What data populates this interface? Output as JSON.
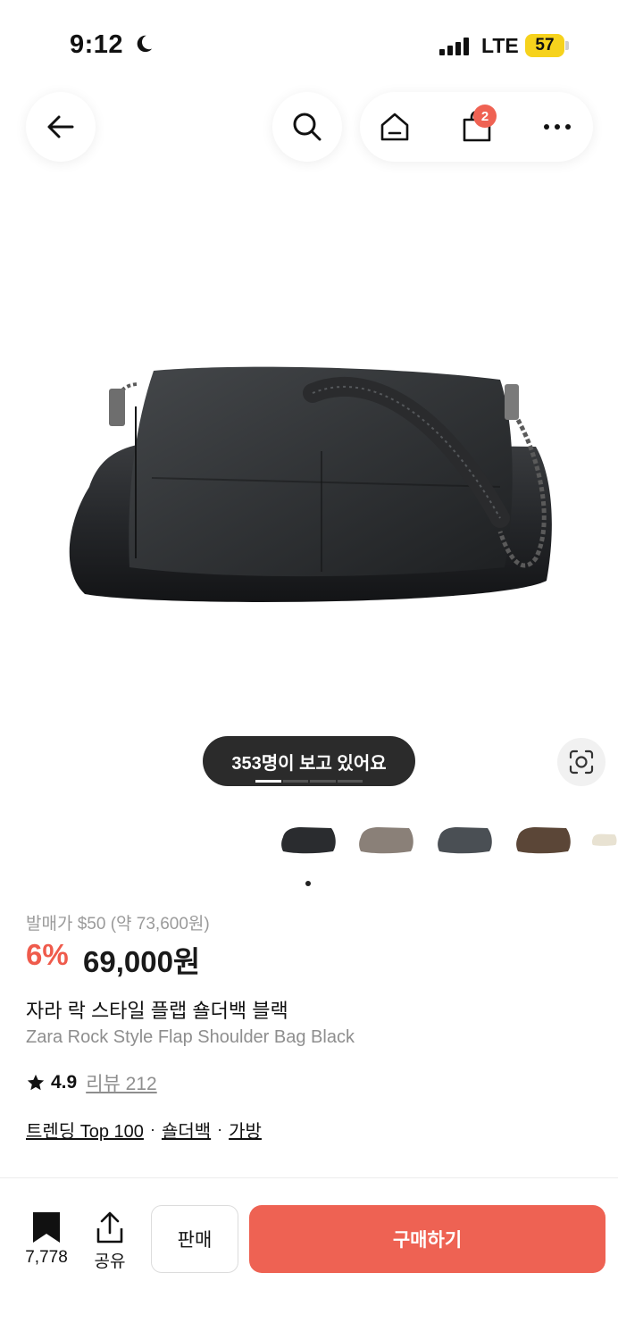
{
  "status_bar": {
    "time": "9:12",
    "network": "LTE",
    "battery": "57"
  },
  "nav": {
    "cart_count": "2"
  },
  "gallery": {
    "viewers_text": "353명이 보고 있어요",
    "thumbnails": [
      {
        "name": "black",
        "color": "#2a2c2f"
      },
      {
        "name": "silver",
        "color": "#8a8078"
      },
      {
        "name": "denim",
        "color": "#4a4f54"
      },
      {
        "name": "brown",
        "color": "#5b4637"
      },
      {
        "name": "ivory",
        "color": "#e8e2d2"
      }
    ]
  },
  "product": {
    "original_price": "발매가 $50 (약 73,600원)",
    "discount": "6%",
    "price": "69,000원",
    "name_ko": "자라 락 스타일 플랩 숄더백 블랙",
    "name_en": "Zara Rock Style Flap Shoulder Bag Black",
    "rating": "4.9",
    "review_label": "리뷰 212",
    "tags": [
      "트렌딩 Top 100",
      "숄더백",
      "가방"
    ]
  },
  "bottom_bar": {
    "bookmark_count": "7,778",
    "share_label": "공유",
    "sell_label": "판매",
    "buy_label": "구매하기"
  },
  "colors": {
    "accent": "#ee6253",
    "discount": "#ef5b4c"
  }
}
